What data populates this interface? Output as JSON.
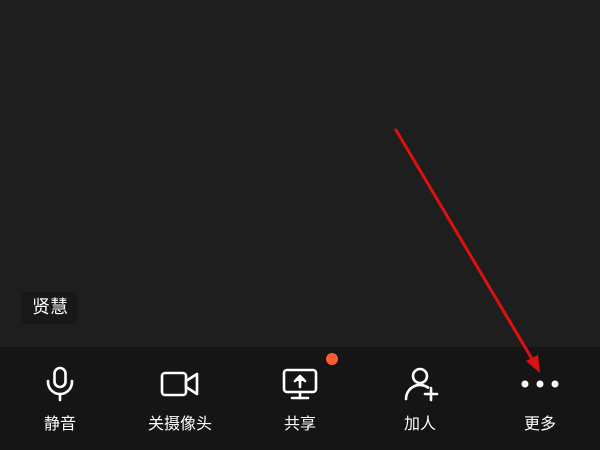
{
  "participant": {
    "name": "贤慧"
  },
  "toolbar": {
    "items": [
      {
        "label": "静音",
        "icon": "microphone-icon"
      },
      {
        "label": "关摄像头",
        "icon": "camera-icon"
      },
      {
        "label": "共享",
        "icon": "screen-share-icon",
        "badge": "notification-dot"
      },
      {
        "label": "加人",
        "icon": "add-person-icon"
      },
      {
        "label": "更多",
        "icon": "more-dots-icon"
      }
    ]
  },
  "colors": {
    "background": "#1e1e1e",
    "toolbar_background": "#151515",
    "badge": "#ff5a36",
    "annotation_arrow": "#e01010",
    "text": "#ffffff"
  }
}
